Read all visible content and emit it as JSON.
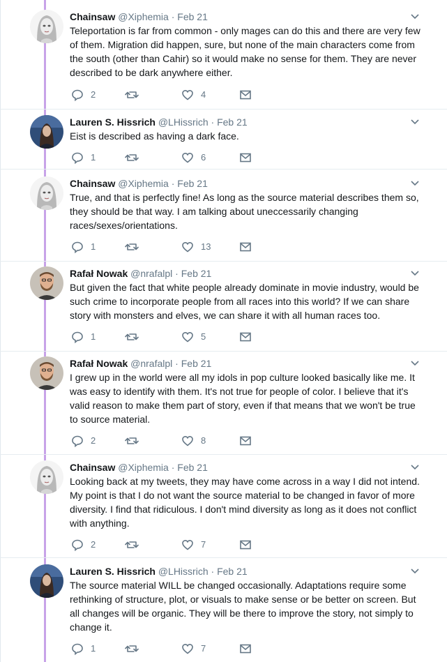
{
  "colors": {
    "thread_line": "#c8a3e8",
    "text": "#14171a",
    "muted": "#657786"
  },
  "icons": {
    "reply": "reply-icon",
    "retweet": "retweet-icon",
    "like": "heart-icon",
    "message": "envelope-icon",
    "menu": "chevron-down-icon"
  },
  "tweets": [
    {
      "name": "Chainsaw",
      "handle": "@Xiphemia",
      "separator": "·",
      "date": "Feb 21",
      "avatar": "girl-sketch",
      "text": "Teleportation is far from common - only mages can do this and there are very few of them. Migration did happen, sure, but none of the main characters come from the south (other than Cahir) so it would make no sense for them. They are never described to be dark anywhere either.",
      "replies": "2",
      "retweets": "",
      "likes": "4"
    },
    {
      "name": "Lauren S. Hissrich",
      "handle": "@LHissrich",
      "separator": "·",
      "date": "Feb 21",
      "avatar": "woman-blue",
      "text": "Eist is described as having a dark face.",
      "replies": "1",
      "retweets": "",
      "likes": "6"
    },
    {
      "name": "Chainsaw",
      "handle": "@Xiphemia",
      "separator": "·",
      "date": "Feb 21",
      "avatar": "girl-sketch",
      "text": "True, and that is perfectly fine! As long as the source material describes them so, they should be that way. I am talking about uneccessarily changing races/sexes/orientations.",
      "replies": "1",
      "retweets": "",
      "likes": "13"
    },
    {
      "name": "Rafał Nowak",
      "handle": "@nrafalpl",
      "separator": "·",
      "date": "Feb 21",
      "avatar": "man-beard",
      "text": "But given the fact that white people already dominate in movie industry, would be such crime to incorporate people from all races into this world? If we can share story with monsters and elves, we can share it with all human races too.",
      "replies": "1",
      "retweets": "",
      "likes": "5"
    },
    {
      "name": "Rafał Nowak",
      "handle": "@nrafalpl",
      "separator": "·",
      "date": "Feb 21",
      "avatar": "man-beard",
      "text": "I grew up in the world were all my idols in pop culture looked basically like me. It was easy to identify with them. It's not true for people of color. I believe that it's valid reason to make them part of story, even if that means that we won't be true to source material.",
      "replies": "2",
      "retweets": "",
      "likes": "8"
    },
    {
      "name": "Chainsaw",
      "handle": "@Xiphemia",
      "separator": "·",
      "date": "Feb 21",
      "avatar": "girl-sketch",
      "text": "Looking back at my tweets, they may have come across in a way I did not intend. My point is that I do not want the source material to be changed in favor of more diversity. I find that ridiculous. I don't mind diversity as long as it does not conflict with anything.",
      "replies": "2",
      "retweets": "",
      "likes": "7"
    },
    {
      "name": "Lauren S. Hissrich",
      "handle": "@LHissrich",
      "separator": "·",
      "date": "Feb 21",
      "avatar": "woman-blue",
      "text": "The source material WILL be changed occasionally. Adaptations require some rethinking of structure, plot, or visuals to make sense or be better on screen. But all changes will be organic. They will be there to improve the story, not simply to change it.",
      "replies": "1",
      "retweets": "",
      "likes": "7"
    }
  ]
}
